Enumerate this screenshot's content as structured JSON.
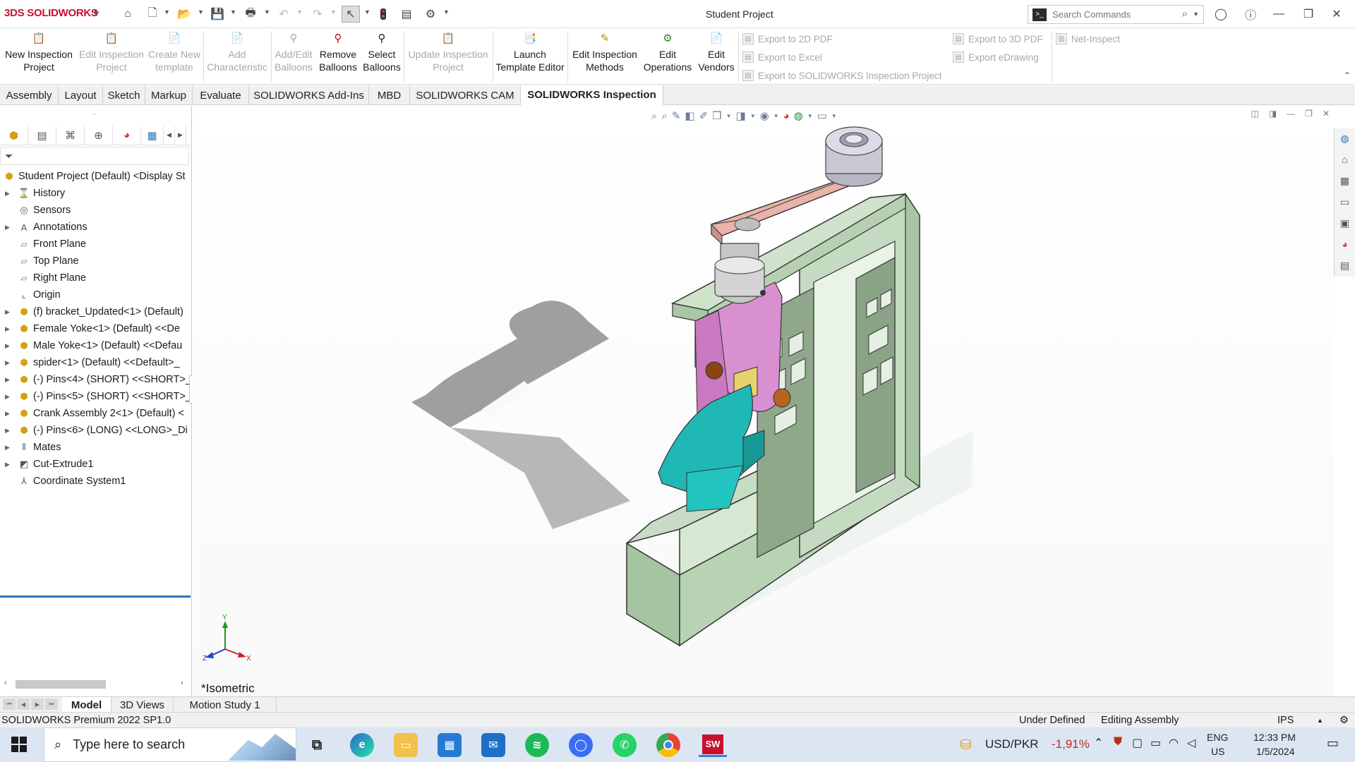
{
  "titlebar": {
    "app_name": "SOLIDWORKS",
    "logo_mark": "3DS",
    "doc_title": "Student Project",
    "search_placeholder": "Search Commands"
  },
  "ribbon": {
    "buttons": [
      {
        "label_l1": "New Inspection",
        "label_l2": "Project",
        "enabled": true
      },
      {
        "label_l1": "Edit Inspection",
        "label_l2": "Project",
        "enabled": false
      },
      {
        "label_l1": "Create New",
        "label_l2": "template",
        "enabled": false
      },
      {
        "label_l1": "Add",
        "label_l2": "Characteristic",
        "enabled": false
      },
      {
        "label_l1": "Add/Edit",
        "label_l2": "Balloons",
        "enabled": false
      },
      {
        "label_l1": "Remove",
        "label_l2": "Balloons",
        "enabled": true
      },
      {
        "label_l1": "Select",
        "label_l2": "Balloons",
        "enabled": true
      },
      {
        "label_l1": "Update Inspection",
        "label_l2": "Project",
        "enabled": false
      },
      {
        "label_l1": "Launch",
        "label_l2": "Template Editor",
        "enabled": true
      },
      {
        "label_l1": "Edit Inspection",
        "label_l2": "Methods",
        "enabled": true
      },
      {
        "label_l1": "Edit",
        "label_l2": "Operations",
        "enabled": true
      },
      {
        "label_l1": "Edit",
        "label_l2": "Vendors",
        "enabled": true
      }
    ],
    "exports": [
      "Export to 2D PDF",
      "Export to Excel",
      "Export to SOLIDWORKS Inspection Project",
      "Export to 3D PDF",
      "Export eDrawing",
      "Net-Inspect"
    ]
  },
  "command_tabs": [
    "Assembly",
    "Layout",
    "Sketch",
    "Markup",
    "Evaluate",
    "SOLIDWORKS Add-Ins",
    "MBD",
    "SOLIDWORKS CAM",
    "SOLIDWORKS Inspection"
  ],
  "active_command_tab": "SOLIDWORKS Inspection",
  "feature_tree": {
    "root": "Student Project (Default) <Display St",
    "items": [
      {
        "label": "History",
        "expandable": true,
        "icon": "history-icon"
      },
      {
        "label": "Sensors",
        "expandable": false,
        "icon": "sensor-icon"
      },
      {
        "label": "Annotations",
        "expandable": true,
        "icon": "annotations-icon"
      },
      {
        "label": "Front Plane",
        "expandable": false,
        "icon": "plane-icon"
      },
      {
        "label": "Top Plane",
        "expandable": false,
        "icon": "plane-icon"
      },
      {
        "label": "Right Plane",
        "expandable": false,
        "icon": "plane-icon"
      },
      {
        "label": "Origin",
        "expandable": false,
        "icon": "origin-icon"
      },
      {
        "label": "(f) bracket_Updated<1> (Default)",
        "expandable": true,
        "icon": "component-icon"
      },
      {
        "label": "Female Yoke<1> (Default) <<De",
        "expandable": true,
        "icon": "component-icon"
      },
      {
        "label": "Male Yoke<1> (Default) <<Defau",
        "expandable": true,
        "icon": "component-icon"
      },
      {
        "label": "spider<1> (Default) <<Default>_",
        "expandable": true,
        "icon": "component-icon"
      },
      {
        "label": "(-) Pins<4> (SHORT) <<SHORT>_",
        "expandable": true,
        "icon": "component-icon"
      },
      {
        "label": "(-) Pins<5> (SHORT) <<SHORT>_",
        "expandable": true,
        "icon": "component-icon"
      },
      {
        "label": "Crank Assembly 2<1> (Default) <",
        "expandable": true,
        "icon": "component-icon"
      },
      {
        "label": "(-) Pins<6> (LONG) <<LONG>_Di",
        "expandable": true,
        "icon": "component-icon"
      },
      {
        "label": "Mates",
        "expandable": true,
        "icon": "mates-icon"
      },
      {
        "label": "Cut-Extrude1",
        "expandable": true,
        "icon": "cut-extrude-icon"
      },
      {
        "label": "Coordinate System1",
        "expandable": false,
        "icon": "coordinate-system-icon"
      }
    ]
  },
  "graphics": {
    "view_label": "*Isometric",
    "triad": {
      "x": "X",
      "y": "Y",
      "z": "Z"
    }
  },
  "model_tabs": [
    "Model",
    "3D Views",
    "Motion Study 1"
  ],
  "active_model_tab": "Model",
  "statusbar": {
    "product": "SOLIDWORKS Premium 2022 SP1.0",
    "state": "Under Defined",
    "mode": "Editing Assembly",
    "units": "IPS"
  },
  "taskbar": {
    "search_placeholder": "Type here to search",
    "ticker_name": "USD/PKR",
    "ticker_change": "-1,91%",
    "lang_1": "ENG",
    "lang_2": "US",
    "time": "12:33 PM",
    "date": "1/5/2024",
    "colors": {
      "ticker_negative": "#c42b1c",
      "accent": "#2e74b5",
      "brand": "#c8102e"
    }
  }
}
